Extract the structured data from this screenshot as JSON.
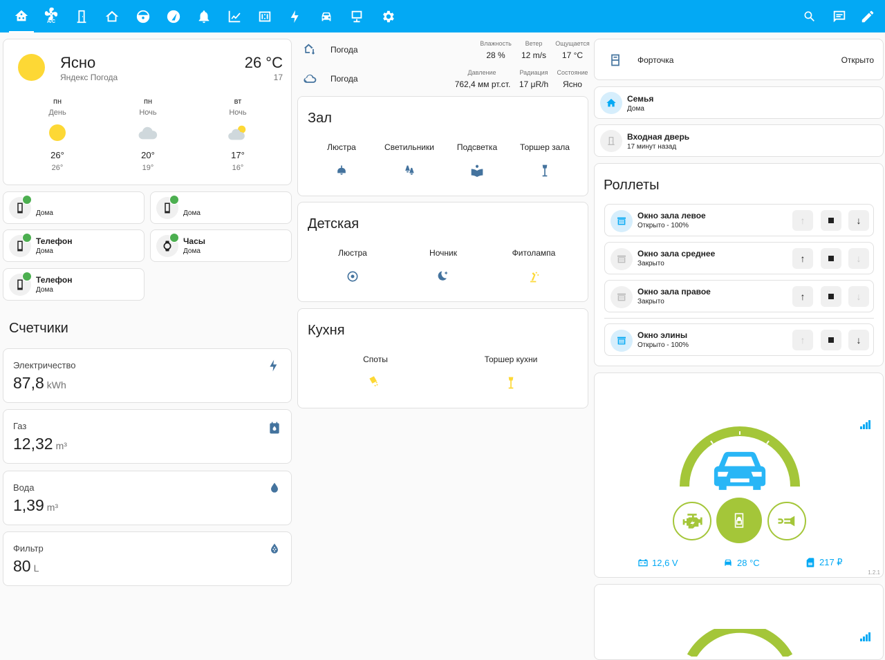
{
  "topbar": {
    "tabs": [
      {
        "icon": "home-assistant-icon"
      },
      {
        "icon": "air-conditioner-icon",
        "text": "A/C"
      },
      {
        "icon": "door-icon"
      },
      {
        "icon": "house-outline-icon"
      },
      {
        "icon": "robot-vacuum-icon"
      },
      {
        "icon": "gauge-icon"
      },
      {
        "icon": "bell-icon"
      },
      {
        "icon": "chart-icon"
      },
      {
        "icon": "calendar-counter-icon"
      },
      {
        "icon": "lightning-icon"
      },
      {
        "icon": "car-icon"
      },
      {
        "icon": "monitor-icon"
      },
      {
        "icon": "gear-icon"
      }
    ],
    "right_icons": [
      "search-icon",
      "chat-icon",
      "pencil-icon"
    ]
  },
  "weather": {
    "condition": "Ясно",
    "source": "Яндекс Погода",
    "temp": "26 °C",
    "temp_low": "17",
    "forecast": [
      {
        "day": "пн",
        "period": "День",
        "high": "26°",
        "low": "26°",
        "icon": "sun"
      },
      {
        "day": "пн",
        "period": "Ночь",
        "high": "20°",
        "low": "19°",
        "icon": "cloud"
      },
      {
        "day": "вт",
        "period": "Ночь",
        "high": "17°",
        "low": "16°",
        "icon": "partly-cloudy"
      }
    ]
  },
  "people": [
    {
      "name": "",
      "state": "Дома"
    },
    {
      "name": "",
      "state": "Дома"
    },
    {
      "name": "Телефон",
      "state": "Дома"
    },
    {
      "name": "Часы",
      "state": "Дома"
    },
    {
      "name": "Телефон",
      "state": "Дома"
    }
  ],
  "counters": {
    "title": "Счетчики",
    "items": [
      {
        "label": "Электричество",
        "value": "87,8",
        "unit": "kWh",
        "icon": "lightning-icon"
      },
      {
        "label": "Газ",
        "value": "12,32",
        "unit": "m³",
        "icon": "gas-meter-icon"
      },
      {
        "label": "Вода",
        "value": "1,39",
        "unit": "m³",
        "icon": "water-drop-icon"
      },
      {
        "label": "Фильтр",
        "value": "80",
        "unit": "L",
        "icon": "filter-drop-icon"
      }
    ]
  },
  "weather_row": {
    "rows": [
      {
        "name": "Погода",
        "labels": [
          "Влажность",
          "Ветер",
          "Ощущается"
        ],
        "values": [
          "28 %",
          "12 m/s",
          "17 °C"
        ]
      },
      {
        "name": "Погода",
        "labels": [
          "Давление",
          "Радиация",
          "Состояние"
        ],
        "values": [
          "762,4 мм рт.ст.",
          "17 μR/h",
          "Ясно"
        ]
      }
    ]
  },
  "rooms": {
    "zal": {
      "title": "Зал",
      "lights": [
        "Люстра",
        "Светильники",
        "Подсветка",
        "Торшер зала"
      ]
    },
    "kids": {
      "title": "Детская",
      "lights": [
        "Люстра",
        "Ночник",
        "Фитолампа"
      ]
    },
    "kitchen": {
      "title": "Кухня",
      "lights": [
        "Споты",
        "Торшер кухни"
      ]
    }
  },
  "right": {
    "vent": {
      "name": "Форточка",
      "state": "Открыто"
    },
    "family": {
      "name": "Семья",
      "state": "Дома"
    },
    "door": {
      "name": "Входная дверь",
      "state": "17 минут назад"
    },
    "rollers": {
      "title": "Роллеты",
      "items": [
        {
          "name": "Окно зала левое",
          "state": "Открыто - 100%",
          "open": true
        },
        {
          "name": "Окно зала среднее",
          "state": "Закрыто",
          "open": false
        },
        {
          "name": "Окно зала правое",
          "state": "Закрыто",
          "open": false
        },
        {
          "name": "Окно элины",
          "state": "Открыто - 100%",
          "open": true
        }
      ]
    },
    "car": {
      "voltage": "12,6 V",
      "temp": "28 °C",
      "balance": "217 ₽",
      "version": "1.2.1"
    }
  },
  "colors": {
    "accent": "#03a9f4",
    "car_green": "#a4c639",
    "badge": "#4caf50",
    "icon_blue": "#44739e",
    "light_yellow": "#fdd835"
  }
}
